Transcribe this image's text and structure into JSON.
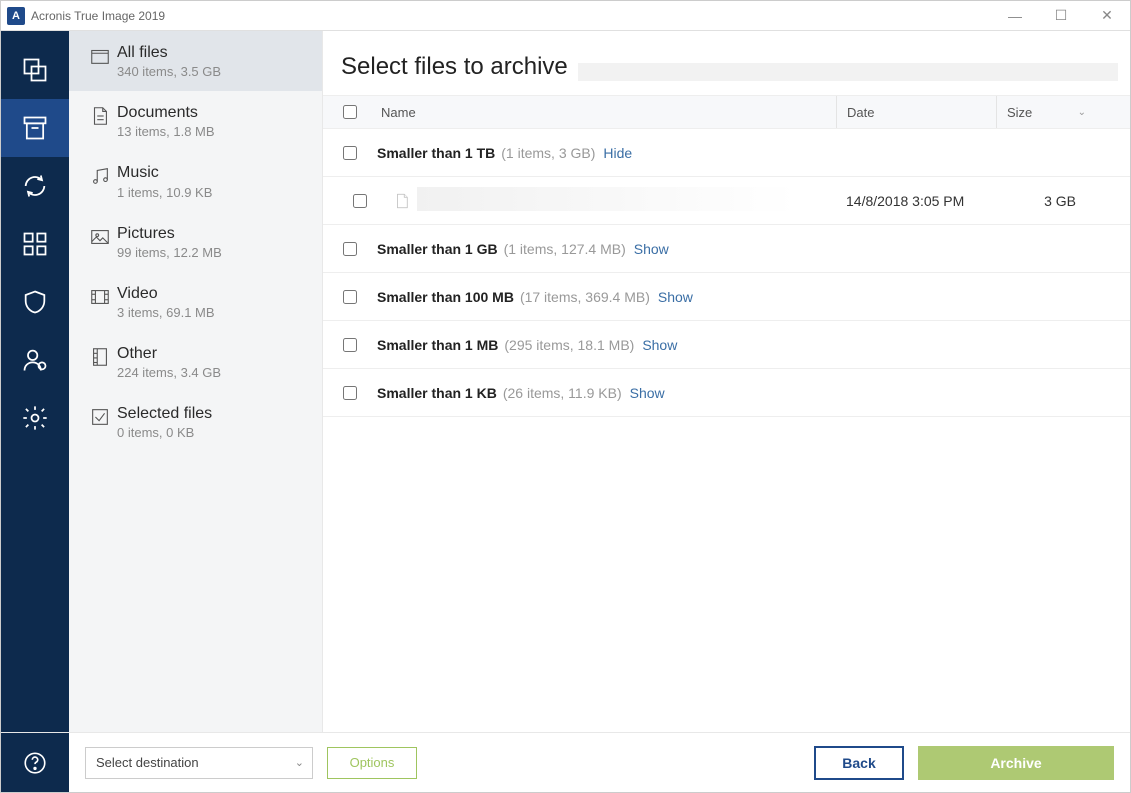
{
  "window": {
    "title": "Acronis True Image 2019",
    "app_initial": "A"
  },
  "rail": {
    "items": [
      "backup",
      "archive",
      "sync",
      "dashboard",
      "protection",
      "account",
      "settings"
    ],
    "help": "help"
  },
  "sidebar": {
    "categories": [
      {
        "title": "All files",
        "sub": "340 items, 3.5 GB",
        "icon": "folder"
      },
      {
        "title": "Documents",
        "sub": "13 items, 1.8 MB",
        "icon": "document"
      },
      {
        "title": "Music",
        "sub": "1 items, 10.9 KB",
        "icon": "music"
      },
      {
        "title": "Pictures",
        "sub": "99 items, 12.2 MB",
        "icon": "picture"
      },
      {
        "title": "Video",
        "sub": "3 items, 69.1 MB",
        "icon": "video"
      },
      {
        "title": "Other",
        "sub": "224 items, 3.4 GB",
        "icon": "other"
      },
      {
        "title": "Selected files",
        "sub": "0 items, 0 KB",
        "icon": "selected"
      }
    ]
  },
  "content": {
    "heading": "Select files to archive",
    "columns": {
      "name": "Name",
      "date": "Date",
      "size": "Size"
    },
    "groups": [
      {
        "title": "Smaller than 1 TB",
        "meta": "(1 items, 3 GB)",
        "toggle": "Hide",
        "expanded": true,
        "files": [
          {
            "name": "",
            "date": "14/8/2018 3:05 PM",
            "size": "3 GB"
          }
        ]
      },
      {
        "title": "Smaller than 1 GB",
        "meta": "(1 items, 127.4 MB)",
        "toggle": "Show",
        "expanded": false
      },
      {
        "title": "Smaller than 100 MB",
        "meta": "(17 items, 369.4 MB)",
        "toggle": "Show",
        "expanded": false
      },
      {
        "title": "Smaller than 1 MB",
        "meta": "(295 items, 18.1 MB)",
        "toggle": "Show",
        "expanded": false
      },
      {
        "title": "Smaller than 1 KB",
        "meta": "(26 items, 11.9 KB)",
        "toggle": "Show",
        "expanded": false
      }
    ]
  },
  "footer": {
    "destination_placeholder": "Select destination",
    "options": "Options",
    "back": "Back",
    "archive": "Archive"
  }
}
